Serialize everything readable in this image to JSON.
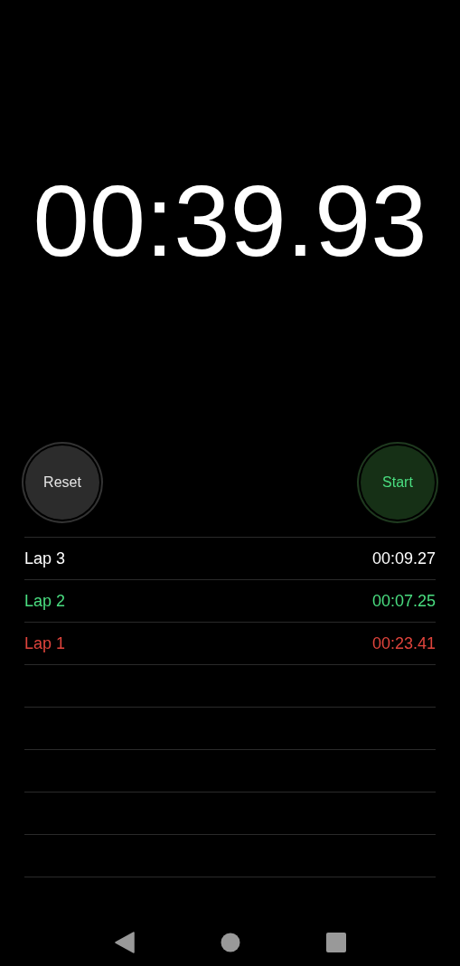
{
  "timer": {
    "display": "00:39.93"
  },
  "buttons": [
    {
      "label": "Reset",
      "kind": "reset"
    },
    {
      "label": "Start",
      "kind": "start"
    }
  ],
  "laps": [
    {
      "label": "Lap 3",
      "time": "00:09.27",
      "color": "#ffffff"
    },
    {
      "label": "Lap 2",
      "time": "00:07.25",
      "color": "#4ade80"
    },
    {
      "label": "Lap 1",
      "time": "00:23.41",
      "color": "#e0443c"
    }
  ]
}
